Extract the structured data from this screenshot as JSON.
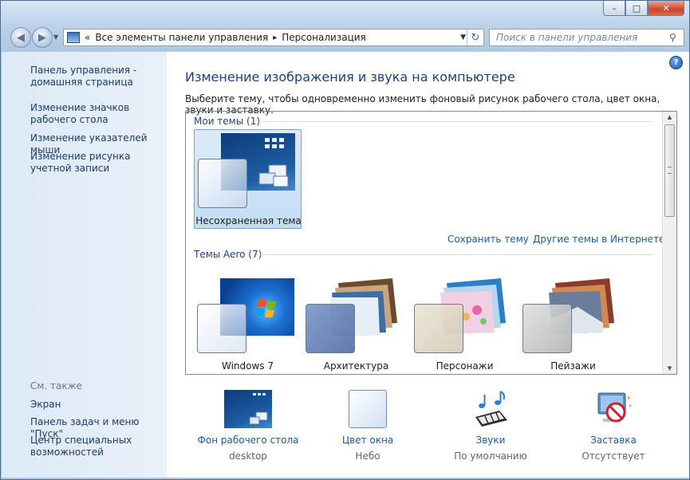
{
  "window": {
    "controls": {
      "minimize": "–",
      "maximize": "□",
      "close": "✕"
    }
  },
  "nav": {
    "address_root_sep": "«",
    "address_parts": [
      "Все элементы панели управления",
      "Персонализация"
    ],
    "address_sep": "▸",
    "search_placeholder": "Поиск в панели управления"
  },
  "sidebar": {
    "home_link": "Панель управления - домашняя страница",
    "links": [
      "Изменение значков рабочего стола",
      "Изменение указателей мыши",
      "Изменение рисунка учетной записи"
    ],
    "see_also_label": "См. также",
    "see_also": [
      "Экран",
      "Панель задач и меню \"Пуск\"",
      "Центр специальных возможностей"
    ]
  },
  "main": {
    "help": "?",
    "heading": "Изменение изображения и звука на компьютере",
    "description": "Выберите тему, чтобы одновременно изменить фоновый рисунок рабочего стола, цвет окна, звуки и заставку.",
    "my_themes": {
      "title": "Мои темы (1)",
      "items": [
        {
          "label": "Несохраненная тема",
          "selected": true,
          "bg_icon": "desktop-thumbnail"
        }
      ]
    },
    "save_theme_link": "Сохранить тему",
    "more_themes_link": "Другие темы в Интернете",
    "aero_themes": {
      "title": "Темы Aero (7)",
      "items": [
        {
          "label": "Windows 7",
          "bg_icon": "windows-logo-wallpaper"
        },
        {
          "label": "Архитектура",
          "bg_icon": "architecture-stack"
        },
        {
          "label": "Персонажи",
          "bg_icon": "characters-stack"
        },
        {
          "label": "Пейзажи",
          "bg_icon": "landscape-stack"
        }
      ]
    },
    "bottom": [
      {
        "title": "Фон рабочего стола",
        "value": "desktop",
        "icon": "desktop-background-icon"
      },
      {
        "title": "Цвет окна",
        "value": "Небо",
        "icon": "window-color-icon"
      },
      {
        "title": "Звуки",
        "value": "По умолчанию",
        "icon": "sounds-icon"
      },
      {
        "title": "Заставка",
        "value": "Отсутствует",
        "icon": "screensaver-icon"
      }
    ]
  },
  "colors": {
    "link": "#1c5aa6",
    "heading": "#1f3f82",
    "selection": "#c3dcf5"
  }
}
